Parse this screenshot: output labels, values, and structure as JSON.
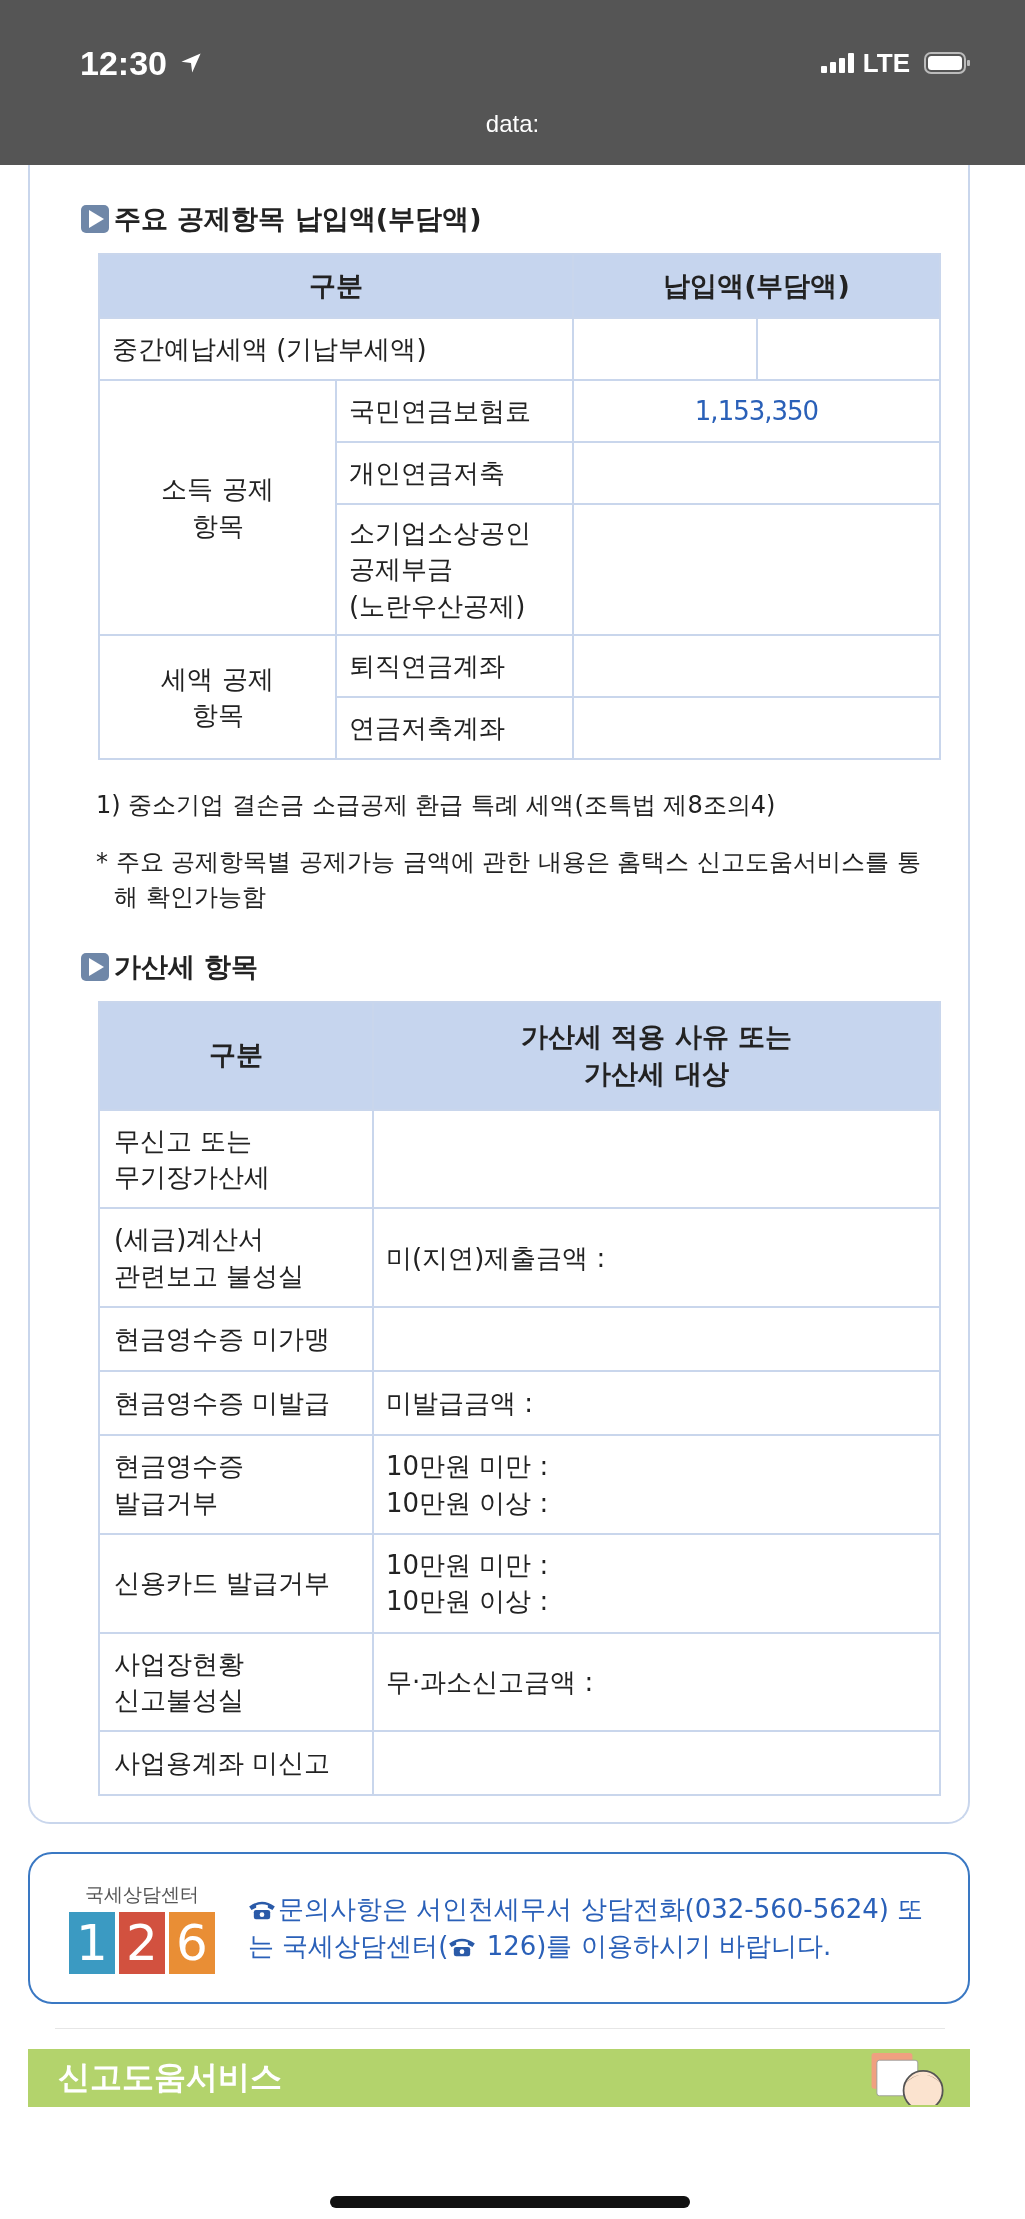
{
  "status_bar": {
    "time": "12:30",
    "network": "LTE"
  },
  "browser": {
    "url": "data:"
  },
  "deduction_section": {
    "heading": "주요 공제항목 납입액(부담액)",
    "columns": [
      "구분",
      "납입액(부담액)"
    ],
    "rows": [
      {
        "kind": "split",
        "label": "중간예납세액 (기납부세액)"
      }
    ],
    "groups": [
      {
        "label": "소득 공제 항목",
        "items": [
          {
            "label": "국민연금보험료",
            "amount": "1,153,350"
          },
          {
            "label": "개인연금저축"
          },
          {
            "label": "소기업소상공인공제부금\n(노란우산공제)"
          }
        ]
      },
      {
        "label": "세액 공제 항목",
        "items": [
          {
            "label": "퇴직연금계좌"
          },
          {
            "label": "연금저축계좌"
          }
        ]
      }
    ],
    "notes": [
      {
        "kind": "footnote",
        "text": "1) 중소기업 결손금 소급공제 환급 특례 세액(조특법 제8조의4)"
      },
      {
        "kind": "asterisk",
        "text": "* 주요 공제항목별 공제가능 금액에 관한 내용은 홈택스 신고도움서비스를 통해 확인가능함"
      }
    ]
  },
  "penalty_section": {
    "heading": "가산세 항목",
    "columns": [
      "구분",
      "가산세 적용 사유 또는\n가산세 대상"
    ],
    "rows": [
      {
        "label": "무신고 또는\n무기장가산세",
        "lines": []
      },
      {
        "label": "(세금)계산서\n관련보고 불성실",
        "lines": [
          "미(지연)제출금액 :"
        ]
      },
      {
        "label": "현금영수증 미가맹",
        "lines": []
      },
      {
        "label": "현금영수증 미발급",
        "lines": [
          "미발급금액 :"
        ]
      },
      {
        "label": "현금영수증\n발급거부",
        "lines": [
          "10만원 미만 :",
          "10만원 이상 :"
        ]
      },
      {
        "label": "신용카드 발급거부",
        "lines": [
          "10만원 미만 :",
          "10만원 이상 :"
        ]
      },
      {
        "label": "사업장현황\n신고불성실",
        "lines": [
          "무·과소신고금액 :"
        ]
      },
      {
        "label": "사업용계좌 미신고",
        "lines": []
      }
    ]
  },
  "contact": {
    "logo_caption": "국세상담센터",
    "logo_digits": [
      "1",
      "2",
      "6"
    ],
    "text_before": "문의사항은 서인천세무서 상담전화(032-560-5624) 또는 국세상담센터(",
    "phone": "126",
    "text_after": ")를 이용하시기 바랍니다."
  },
  "banner": {
    "title": "신고도움서비스"
  }
}
